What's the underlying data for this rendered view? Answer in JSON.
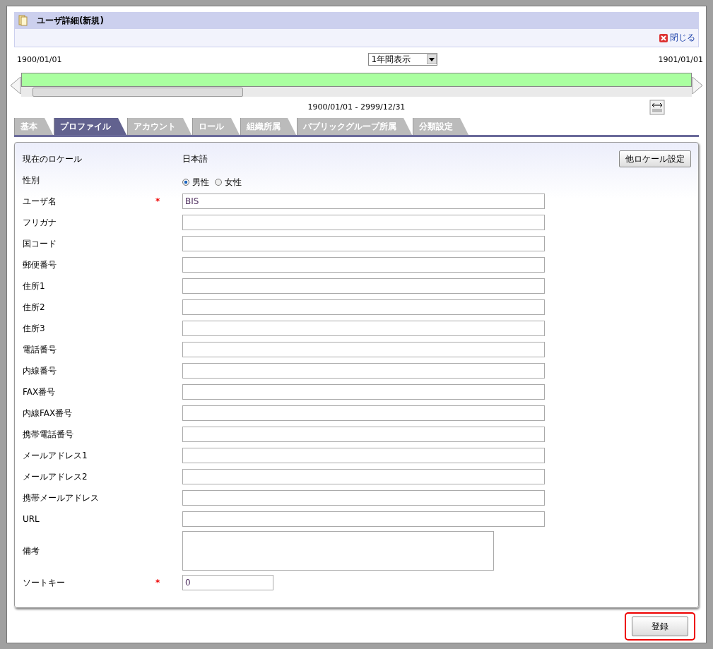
{
  "window": {
    "title": "ユーザ詳細(新規)",
    "close": "閉じる"
  },
  "timeline": {
    "start": "1900/01/01",
    "end": "1901/01/01",
    "range_select": "1年間表示",
    "range": "1900/01/01 - 2999/12/31"
  },
  "tabs": [
    {
      "label": "基本",
      "selected": false
    },
    {
      "label": "プロファイル",
      "selected": true
    },
    {
      "label": "アカウント",
      "selected": false
    },
    {
      "label": "ロール",
      "selected": false
    },
    {
      "label": "組織所属",
      "selected": false
    },
    {
      "label": "パブリックグループ所属",
      "selected": false
    },
    {
      "label": "分類設定",
      "selected": false
    }
  ],
  "locale": {
    "label": "現在のロケール",
    "value": "日本語",
    "button": "他ロケール設定"
  },
  "gender": {
    "label": "性別",
    "options": [
      {
        "label": "男性",
        "selected": true
      },
      {
        "label": "女性",
        "selected": false
      }
    ]
  },
  "fields": [
    {
      "kind": "text",
      "label": "ユーザ名",
      "required": true,
      "value": "BIS"
    },
    {
      "kind": "text",
      "label": "フリガナ",
      "required": false
    },
    {
      "kind": "text",
      "label": "国コード",
      "required": false
    },
    {
      "kind": "text",
      "label": "郵便番号",
      "required": false
    },
    {
      "kind": "text",
      "label": "住所1",
      "required": false
    },
    {
      "kind": "text",
      "label": "住所2",
      "required": false
    },
    {
      "kind": "text",
      "label": "住所3",
      "required": false
    },
    {
      "kind": "text",
      "label": "電話番号",
      "required": false
    },
    {
      "kind": "text",
      "label": "内線番号",
      "required": false
    },
    {
      "kind": "text",
      "label": "FAX番号",
      "required": false
    },
    {
      "kind": "text",
      "label": "内線FAX番号",
      "required": false
    },
    {
      "kind": "text",
      "label": "携帯電話番号",
      "required": false
    },
    {
      "kind": "text",
      "label": "メールアドレス1",
      "required": false
    },
    {
      "kind": "text",
      "label": "メールアドレス2",
      "required": false
    },
    {
      "kind": "text",
      "label": "携帯メールアドレス",
      "required": false
    },
    {
      "kind": "text",
      "label": "URL",
      "required": false
    },
    {
      "kind": "textarea",
      "label": "備考",
      "required": false
    },
    {
      "kind": "short",
      "label": "ソートキー",
      "required": true,
      "value": "0"
    }
  ],
  "required_mark": "*",
  "submit": {
    "label": "登録",
    "highlighted": true
  }
}
